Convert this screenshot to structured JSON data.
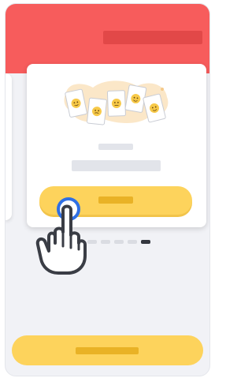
{
  "screen": {
    "colors": {
      "header_background": "#f75c5c",
      "header_bar": "#e24848",
      "page_background": "#f1f2f6",
      "card_background": "#ffffff",
      "button_yellow": "#fdd35c",
      "button_label_bar": "#e9b226",
      "placeholder_gray": "#e2e4ea",
      "tap_ring_blue": "#2f6fe4",
      "active_dot": "#34373f"
    },
    "header": {
      "title_placeholder_icon": "text-placeholder-bar"
    },
    "card": {
      "illustration_icon": "emoji-cards-illustration",
      "primary_button_icon": "text-placeholder-bar"
    },
    "pagination": {
      "total": 7,
      "active_index": 6
    },
    "bottom_button_icon": "text-placeholder-bar",
    "gesture": {
      "hand_icon": "pointing-hand-icon",
      "ring_icon": "tap-ring-icon"
    }
  }
}
